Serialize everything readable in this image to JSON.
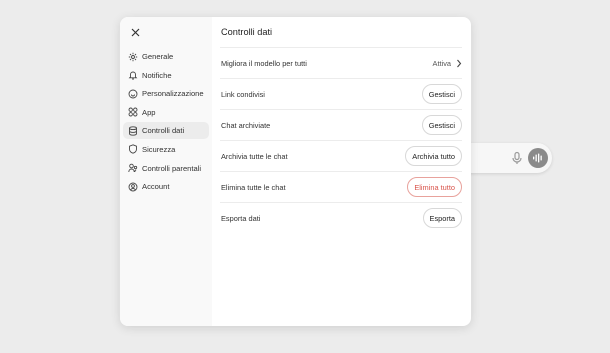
{
  "sidebar": {
    "items": [
      {
        "label": "Generale",
        "icon": "gear-icon"
      },
      {
        "label": "Notifiche",
        "icon": "bell-icon"
      },
      {
        "label": "Personalizzazione",
        "icon": "palette-icon"
      },
      {
        "label": "App",
        "icon": "apps-grid-icon"
      },
      {
        "label": "Controlli dati",
        "icon": "database-icon",
        "active": true
      },
      {
        "label": "Sicurezza",
        "icon": "shield-icon"
      },
      {
        "label": "Controlli parentali",
        "icon": "people-icon"
      },
      {
        "label": "Account",
        "icon": "user-circle-icon"
      }
    ]
  },
  "main": {
    "title": "Controlli dati",
    "rows": [
      {
        "label": "Migliora il modello per tutti",
        "action": "Attiva",
        "type": "link"
      },
      {
        "label": "Link condivisi",
        "action": "Gestisci",
        "type": "button"
      },
      {
        "label": "Chat archiviate",
        "action": "Gestisci",
        "type": "button"
      },
      {
        "label": "Archivia tutte le chat",
        "action": "Archivia tutto",
        "type": "button"
      },
      {
        "label": "Elimina tutte le chat",
        "action": "Elimina tutto",
        "type": "danger"
      },
      {
        "label": "Esporta dati",
        "action": "Esporta",
        "type": "button"
      }
    ]
  },
  "colors": {
    "danger": "#d9534a",
    "active_nav_bg": "#ececec",
    "sidebar_bg": "#f9f9f9"
  }
}
